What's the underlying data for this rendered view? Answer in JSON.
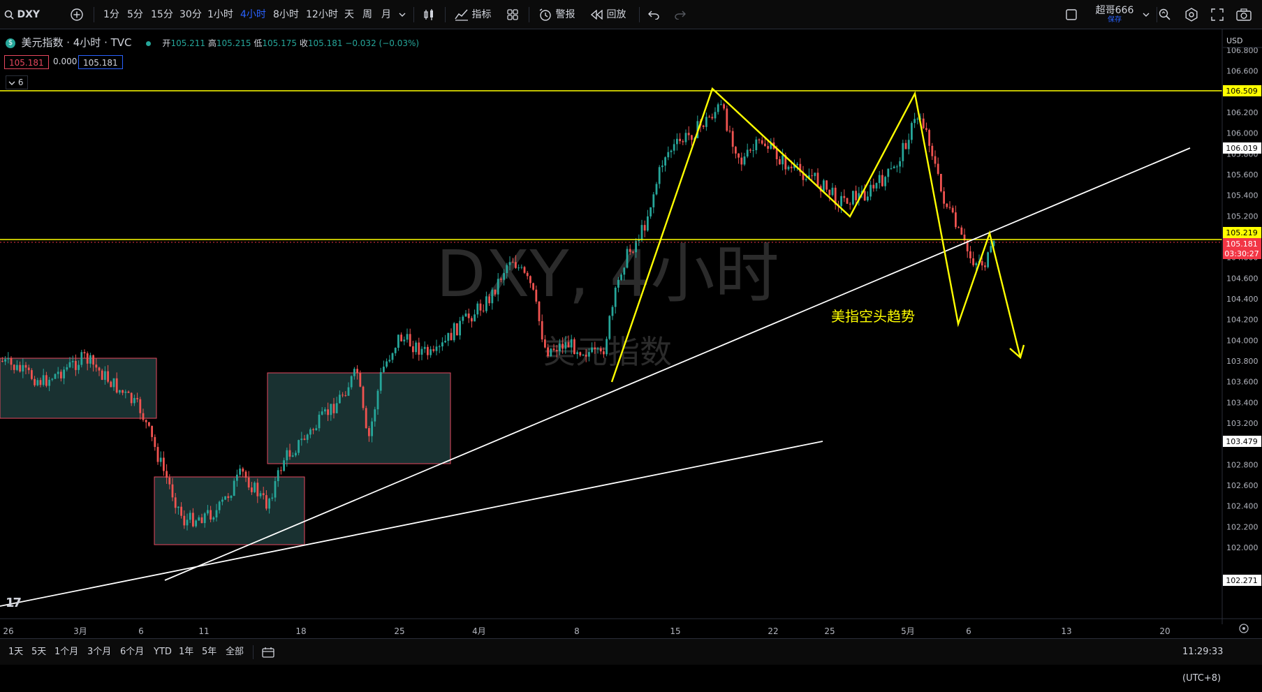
{
  "topbar": {
    "symbol": "DXY",
    "intervals": [
      "1分",
      "5分",
      "15分",
      "30分",
      "1小时",
      "4小时",
      "8小时",
      "12小时",
      "天",
      "周",
      "月"
    ],
    "active_interval": "4小时",
    "indicators_label": "指标",
    "alerts_label": "警报",
    "replay_label": "回放",
    "user_name": "超哥666",
    "save_label": "保存"
  },
  "legend": {
    "title": "美元指数 · 4小时 · TVC",
    "open_label": "开",
    "open": "105.211",
    "high_label": "高",
    "high": "105.215",
    "low_label": "低",
    "low": "105.175",
    "close_label": "收",
    "close": "105.181",
    "change": "−0.032 (−0.03%)",
    "bid": "105.181",
    "spread": "0.000",
    "ask": "105.181",
    "indicator_count": "6"
  },
  "watermark": {
    "symbol": "DXY, 4小时",
    "name": "美元指数"
  },
  "annotation": {
    "text": "美指空头趋势"
  },
  "price_axis": {
    "currency": "USD",
    "ticks": [
      "106.800",
      "106.600",
      "106.400",
      "106.200",
      "106.000",
      "105.800",
      "105.600",
      "105.400",
      "105.200",
      "105.000",
      "104.800",
      "104.600",
      "104.400",
      "104.200",
      "104.000",
      "103.800",
      "103.600",
      "103.400",
      "103.200",
      "103.000",
      "102.800",
      "102.600",
      "102.400",
      "102.200",
      "102.000"
    ],
    "badges": {
      "top_line": "106.509",
      "trend_end": "106.019",
      "mid_line": "105.219",
      "last_price": "105.181",
      "countdown": "03:30:27",
      "low_line_end": "103.479",
      "bottom_line": "102.271"
    },
    "colors": {
      "yellow": "#ffff00",
      "last": "#f23645",
      "up": "#26a69a",
      "down": "#ef5350"
    }
  },
  "time_axis": {
    "ticks": [
      "26",
      "3月",
      "6",
      "11",
      "18",
      "25",
      "4月",
      "8",
      "15",
      "22",
      "25",
      "5月",
      "6",
      "13",
      "20"
    ]
  },
  "bottombar": {
    "ranges": [
      "1天",
      "5天",
      "1个月",
      "3个月",
      "6个月",
      "YTD",
      "1年",
      "5年",
      "全部"
    ],
    "clock": "11:29:33 (UTC+8)"
  }
}
